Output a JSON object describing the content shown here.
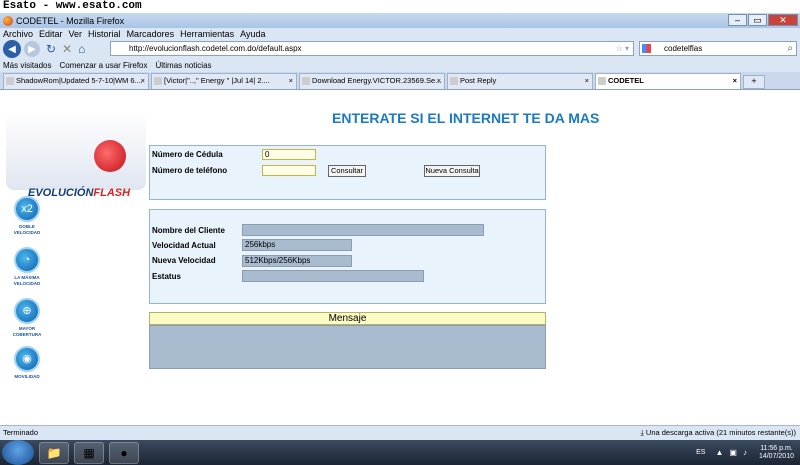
{
  "watermark": "Esato - www.esato.com",
  "window": {
    "title": "CODETEL - Mozilla Firefox"
  },
  "menu": [
    "Archivo",
    "Editar",
    "Ver",
    "Historial",
    "Marcadores",
    "Herramientas",
    "Ayuda"
  ],
  "address": {
    "url": "http://evolucionflash.codetel.com.do/default.aspx"
  },
  "search": {
    "value": "codetelflas"
  },
  "bookmarks": [
    "Más visitados",
    "Comenzar a usar Firefox",
    "Últimas noticias"
  ],
  "tabs": [
    {
      "label": "ShadowRom|Updated 5-7-10|WM 6...."
    },
    {
      "label": "[Victor|\"..,\" Energy \" |Jul 14| 2...."
    },
    {
      "label": "Download Energy.VICTOR.23569.Se..."
    },
    {
      "label": "Post Reply"
    },
    {
      "label": "CODETEL"
    }
  ],
  "page": {
    "logo": {
      "part1": "EVOLUCIÓN",
      "part2": "FLASH"
    },
    "features": [
      {
        "label": "DOBLE VELOCIDAD",
        "icon": "x2-icon",
        "glyph": "x2"
      },
      {
        "label": "LA MÁXIMA VELOCIDAD",
        "icon": "speedometer-icon",
        "glyph": "◔"
      },
      {
        "label": "MAYOR COBERTURA",
        "icon": "coverage-icon",
        "glyph": "⊕"
      },
      {
        "label": "MOVILIDAD",
        "icon": "wifi-icon",
        "glyph": "◉"
      }
    ],
    "headline": "ENTERATE SI EL INTERNET TE DA MAS",
    "form": {
      "cedula_label": "Número de Cédula",
      "cedula_value": "0",
      "telefono_label": "Número de teléfono",
      "telefono_value": "",
      "consultar": "Consultar",
      "nueva": "Nueva Consulta"
    },
    "results": {
      "cliente_label": "Nombre del Cliente",
      "cliente_value": "",
      "vel_actual_label": "Velocidad Actual",
      "vel_actual_value": "256kbps",
      "vel_nueva_label": "Nueva Velocidad",
      "vel_nueva_value": "512Kbps/256Kbps",
      "estatus_label": "Estatus",
      "estatus_value": ""
    },
    "mensaje": "Mensaje"
  },
  "status": {
    "left": "Terminado",
    "right": "Una descarga activa (21 minutos restante(s))"
  },
  "taskbar": {
    "lang": "ES",
    "time": "11:56 p.m.",
    "date": "14/07/2010"
  }
}
